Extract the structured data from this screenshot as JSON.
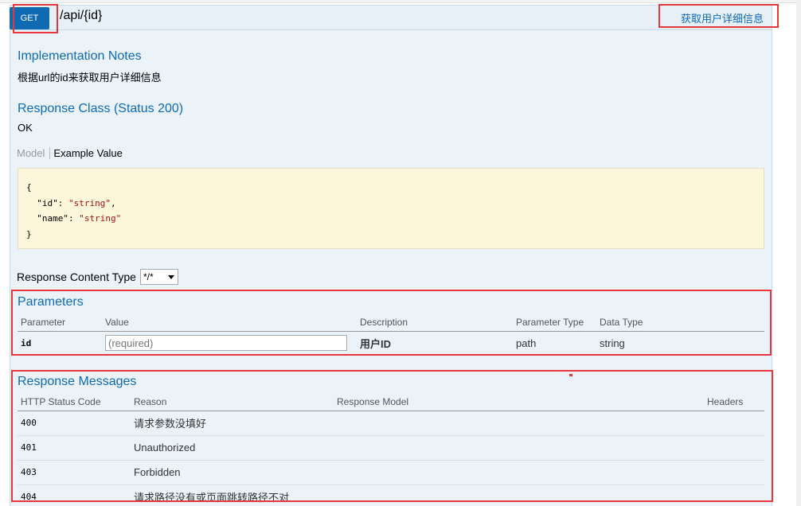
{
  "operation": {
    "method": "GET",
    "path": "/api/{id}",
    "summary": "获取用户详细信息"
  },
  "implementation_notes": {
    "heading": "Implementation Notes",
    "text": "根据url的id来获取用户详细信息"
  },
  "response_class": {
    "heading": "Response Class (Status 200)",
    "text": "OK",
    "tabs": [
      "Model",
      "Example Value"
    ],
    "example": {
      "open": "{",
      "id_key": "\"id\"",
      "id_val": "\"string\"",
      "name_key": "\"name\"",
      "name_val": "\"string\"",
      "close": "}"
    }
  },
  "response_content_type": {
    "label": "Response Content Type",
    "selected": "*/*"
  },
  "parameters": {
    "heading": "Parameters",
    "columns": [
      "Parameter",
      "Value",
      "Description",
      "Parameter Type",
      "Data Type"
    ],
    "rows": [
      {
        "name": "id",
        "placeholder": "(required)",
        "description": "用户ID",
        "param_type": "path",
        "data_type": "string"
      }
    ]
  },
  "response_messages": {
    "heading": "Response Messages",
    "columns": [
      "HTTP Status Code",
      "Reason",
      "Response Model",
      "Headers"
    ],
    "rows": [
      {
        "code": "400",
        "reason": "请求参数没填好"
      },
      {
        "code": "401",
        "reason": "Unauthorized"
      },
      {
        "code": "403",
        "reason": "Forbidden"
      },
      {
        "code": "404",
        "reason": "请求路径没有或页面跳转路径不对"
      }
    ]
  },
  "colors": {
    "accent": "#0f6ab4",
    "highlight_box": "#e8363d",
    "panel_bg": "#ebf3f9",
    "code_bg": "#fcf6db"
  }
}
